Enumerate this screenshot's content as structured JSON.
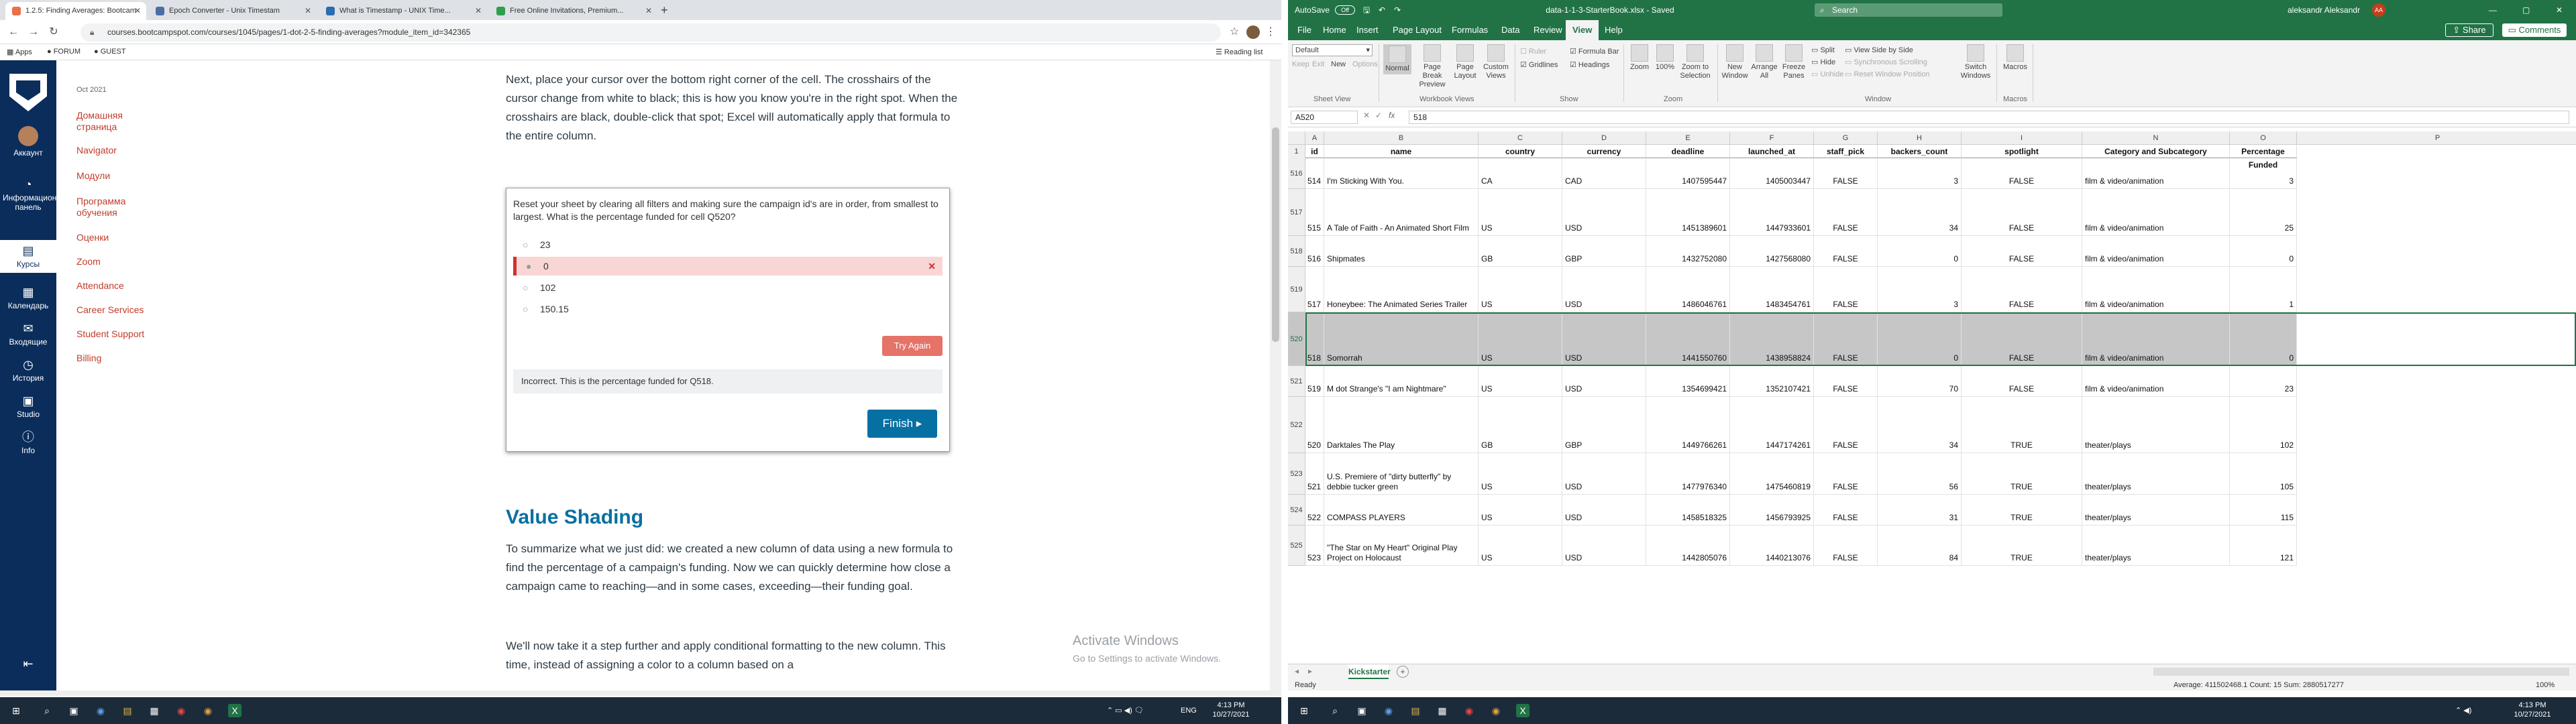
{
  "browser": {
    "tabs": [
      {
        "title": "1.2.5: Finding Averages: Bootcam",
        "color": "#e8704d"
      },
      {
        "title": "Epoch Converter - Unix Timestam",
        "color": "#4a6fa5"
      },
      {
        "title": "What is Timestamp - UNIX Time...",
        "color": "#2b6cb0"
      },
      {
        "title": "Free Online Invitations, Premium...",
        "color": "#2e9e4f"
      }
    ],
    "url": "courses.bootcampspot.com/courses/1045/pages/1-dot-2-5-finding-averages?module_item_id=342365",
    "bookmarks": [
      "Apps",
      "FORUM",
      "GUEST"
    ],
    "reading_list": "Reading list"
  },
  "canvas_nav": [
    {
      "label": "Аккаунт",
      "icon": "avatar-icon"
    },
    {
      "label": "Информационная панель",
      "icon": "dashboard-icon"
    },
    {
      "label": "Курсы",
      "icon": "courses-icon"
    },
    {
      "label": "Календарь",
      "icon": "calendar-icon"
    },
    {
      "label": "Входящие",
      "icon": "inbox-icon"
    },
    {
      "label": "История",
      "icon": "history-icon"
    },
    {
      "label": "Studio",
      "icon": "studio-icon"
    },
    {
      "label": "Info",
      "icon": "info-icon"
    }
  ],
  "course_nav": {
    "term": "Oct 2021",
    "items": [
      "Домашняя страница",
      "Navigator",
      "Модули",
      "Программа обучения",
      "Оценки",
      "Zoom",
      "Attendance",
      "Career Services",
      "Student Support",
      "Billing"
    ]
  },
  "content": {
    "intro": "Next, place your cursor over the bottom right corner of the cell. The crosshairs of the cursor change from white to black; this is how you know you're in the right spot. When the crosshairs are black, double-click that spot; Excel will automatically apply that formula to the entire column.",
    "quiz": {
      "question": "Reset your sheet by clearing all filters and making sure the campaign id's are in order, from smallest to largest. What is the percentage funded for cell Q520?",
      "options": [
        "23",
        "0",
        "102",
        "150.15"
      ],
      "try_again": "Try Again",
      "feedback": "Incorrect. This is the percentage funded for Q518.",
      "finish": "Finish"
    },
    "section_title": "Value Shading",
    "para2": "To summarize what we just did: we created a new column of data using a new formula to find the percentage of a campaign's funding. Now we can quickly determine how close a campaign came to reaching—and in some cases, exceeding—their funding goal.",
    "para3": "We'll now take it a step further and apply conditional formatting to the new column. This time, instead of assigning a color to a column based on a",
    "activate_title": "Activate Windows",
    "activate_sub": "Go to Settings to activate Windows."
  },
  "excel": {
    "autosave": "AutoSave",
    "autosave_state": "Off",
    "filename": "data-1-1-3-StarterBook.xlsx - Saved",
    "search": "Search",
    "user": "aleksandr Aleksandr",
    "user_initials": "AA",
    "menus": [
      "File",
      "Home",
      "Insert",
      "Page Layout",
      "Formulas",
      "Data",
      "Review",
      "View",
      "Help"
    ],
    "share": "Share",
    "comments": "Comments",
    "sheet_view_default": "Default",
    "ribbon_labels": {
      "keep": "Keep",
      "exit": "Exit",
      "new": "New",
      "options": "Options",
      "normal": "Normal",
      "page_break": "Page Break Preview",
      "page_layout": "Page Layout",
      "custom_views": "Custom Views",
      "ruler": "Ruler",
      "formula_bar": "Formula Bar",
      "gridlines": "Gridlines",
      "headings": "Headings",
      "zoom": "Zoom",
      "zoom100": "100%",
      "zoom_sel": "Zoom to Selection",
      "new_window": "New Window",
      "arrange_all": "Arrange All",
      "freeze": "Freeze Panes",
      "split": "Split",
      "hide": "Hide",
      "unhide": "Unhide",
      "side_by_side": "View Side by Side",
      "sync_scroll": "Synchronous Scrolling",
      "reset_pos": "Reset Window Position",
      "switch_windows": "Switch Windows",
      "macros": "Macros"
    },
    "ribbon_groups": [
      "Sheet View",
      "Workbook Views",
      "Show",
      "Zoom",
      "Window",
      "Macros"
    ],
    "namebox": "A520",
    "formula_value": "518",
    "columns": [
      "A",
      "B",
      "C",
      "D",
      "E",
      "F",
      "G",
      "H",
      "I",
      "J",
      "K",
      "L",
      "M",
      "N",
      "O",
      "P"
    ],
    "headers": [
      "id",
      "name",
      "country",
      "currency",
      "deadline",
      "launched_at",
      "staff_pick",
      "backers_count",
      "spotlight",
      "Category and Subcategory",
      "Percentage Funded"
    ],
    "rows": [
      {
        "row": "516",
        "id": "514",
        "name": "I'm Sticking With You.",
        "country": "CA",
        "currency": "CAD",
        "deadline": "1407595447",
        "launched": "1405003447",
        "staff": "FALSE",
        "backers": "3",
        "spot": "FALSE",
        "cat": "film & video/animation",
        "pct": "3"
      },
      {
        "row": "517",
        "id": "515",
        "name": "A Tale of Faith - An Animated Short Film",
        "country": "US",
        "currency": "USD",
        "deadline": "1451389601",
        "launched": "1447933601",
        "staff": "FALSE",
        "backers": "34",
        "spot": "FALSE",
        "cat": "film & video/animation",
        "pct": "25"
      },
      {
        "row": "518",
        "id": "516",
        "name": "Shipmates",
        "country": "GB",
        "currency": "GBP",
        "deadline": "1432752080",
        "launched": "1427568080",
        "staff": "FALSE",
        "backers": "0",
        "spot": "FALSE",
        "cat": "film & video/animation",
        "pct": "0"
      },
      {
        "row": "519",
        "id": "517",
        "name": "Honeybee: The Animated Series Trailer",
        "country": "US",
        "currency": "USD",
        "deadline": "1486046761",
        "launched": "1483454761",
        "staff": "FALSE",
        "backers": "3",
        "spot": "FALSE",
        "cat": "film & video/animation",
        "pct": "1"
      },
      {
        "row": "520",
        "id": "518",
        "name": "Somorrah",
        "country": "US",
        "currency": "USD",
        "deadline": "1441550760",
        "launched": "1438958824",
        "staff": "FALSE",
        "backers": "0",
        "spot": "FALSE",
        "cat": "film & video/animation",
        "pct": "0"
      },
      {
        "row": "521",
        "id": "519",
        "name": "M dot Strange's \"I am Nightmare\"",
        "country": "US",
        "currency": "USD",
        "deadline": "1354699421",
        "launched": "1352107421",
        "staff": "FALSE",
        "backers": "70",
        "spot": "FALSE",
        "cat": "film & video/animation",
        "pct": "23"
      },
      {
        "row": "522",
        "id": "520",
        "name": "Darktales The Play",
        "country": "GB",
        "currency": "GBP",
        "deadline": "1449766261",
        "launched": "1447174261",
        "staff": "FALSE",
        "backers": "34",
        "spot": "TRUE",
        "cat": "theater/plays",
        "pct": "102"
      },
      {
        "row": "523",
        "id": "521",
        "name": "U.S. Premiere of \"dirty butterfly\" by debbie tucker green",
        "country": "US",
        "currency": "USD",
        "deadline": "1477976340",
        "launched": "1475460819",
        "staff": "FALSE",
        "backers": "56",
        "spot": "TRUE",
        "cat": "theater/plays",
        "pct": "105"
      },
      {
        "row": "524",
        "id": "522",
        "name": "COMPASS PLAYERS",
        "country": "US",
        "currency": "USD",
        "deadline": "1458518325",
        "launched": "1456793925",
        "staff": "FALSE",
        "backers": "31",
        "spot": "TRUE",
        "cat": "theater/plays",
        "pct": "115"
      },
      {
        "row": "525",
        "id": "523",
        "name": "\"The Star on My Heart\" Original Play Project on Holocaust",
        "country": "US",
        "currency": "USD",
        "deadline": "1442805076",
        "launched": "1440213076",
        "staff": "FALSE",
        "backers": "84",
        "spot": "TRUE",
        "cat": "theater/plays",
        "pct": "121"
      }
    ],
    "sheet_tab": "Kickstarter",
    "status": {
      "ready": "Ready",
      "summary": "Average: 411502468.1    Count: 15    Sum: 2880517277",
      "zoom": "100%"
    }
  },
  "taskbar": {
    "time": "4:13 PM",
    "date": "10/27/2021",
    "lang": "ENG"
  }
}
